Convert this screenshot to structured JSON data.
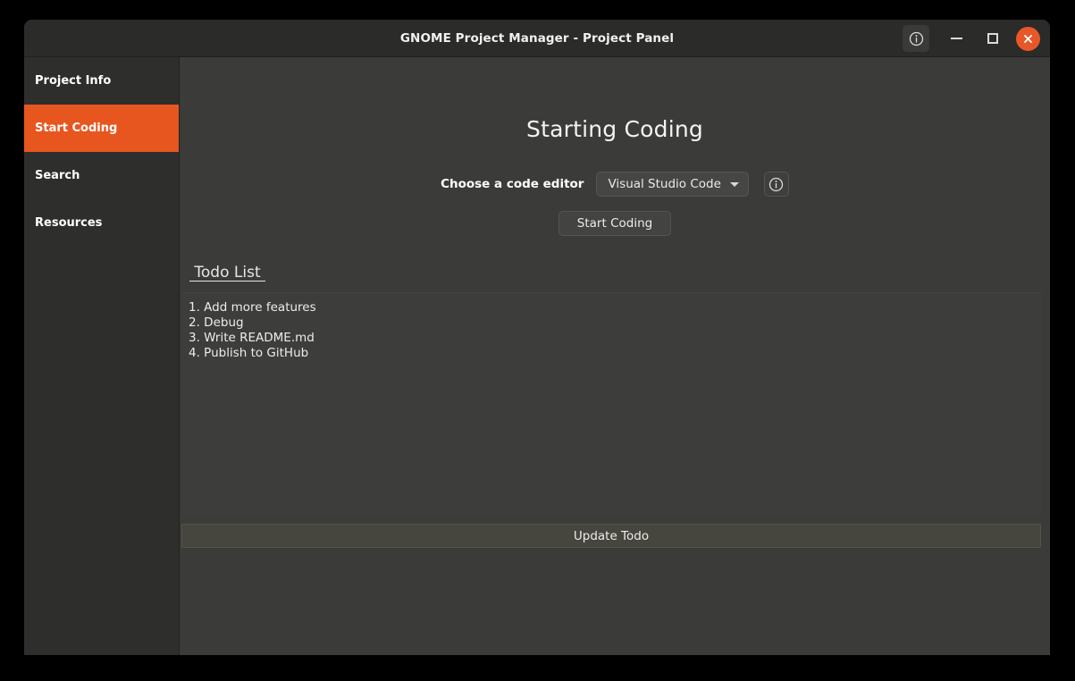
{
  "window": {
    "title": "GNOME Project Manager - Project Panel",
    "controls": {
      "info_label": "info",
      "minimize_label": "minimize",
      "maximize_label": "maximize",
      "close_label": "close"
    },
    "accent_color": "#e8561f",
    "close_color": "#e8572a",
    "titlebar_color": "#2b2b29",
    "sidebar_color": "#2e2e2c",
    "content_color": "#3b3b39"
  },
  "sidebar": {
    "items": [
      {
        "label": "Project Info",
        "selected": false
      },
      {
        "label": "Start Coding",
        "selected": true
      },
      {
        "label": "Search",
        "selected": false
      },
      {
        "label": "Resources",
        "selected": false
      }
    ]
  },
  "main": {
    "page_title": "Starting Coding",
    "editor_label": "Choose a code editor",
    "editor_selected": "Visual Studio Code",
    "editor_options": [
      "Visual Studio Code"
    ],
    "editor_info_label": "editor information",
    "start_button": "Start Coding",
    "todo_header": " Todo List ",
    "todo_items": [
      "1. Add more features",
      "2. Debug",
      "3. Write README.md",
      "4. Publish to GitHub"
    ],
    "update_button": "Update Todo"
  }
}
